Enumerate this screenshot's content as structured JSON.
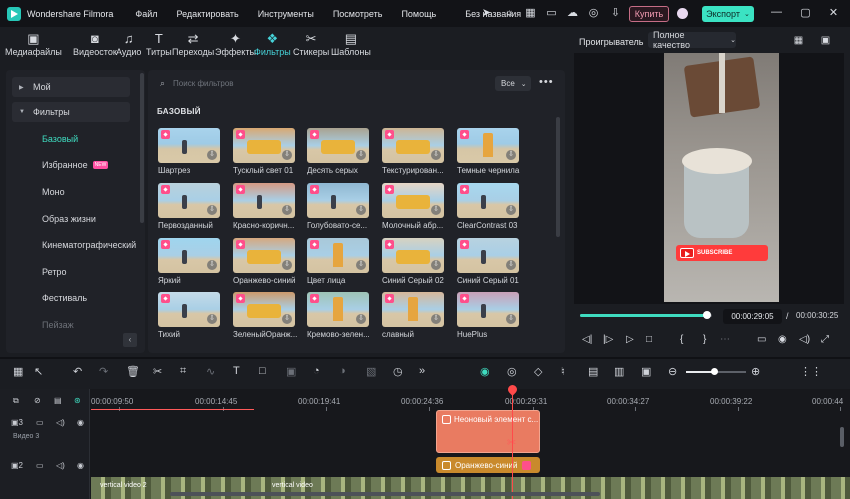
{
  "titlebar": {
    "app_name": "Wondershare Filmora",
    "menu": [
      "Файл",
      "Редактировать",
      "Инструменты",
      "Посмотреть",
      "Помощь"
    ],
    "project_name": "Без названия",
    "buy_label": "Купить",
    "export_label": "Экспорт"
  },
  "media_tabs": [
    {
      "label": "Медиафайлы",
      "icon": "media-icon"
    },
    {
      "label": "Видеосток",
      "icon": "stock-video-icon"
    },
    {
      "label": "Аудио",
      "icon": "music-note-icon"
    },
    {
      "label": "Титры",
      "icon": "title-t-icon"
    },
    {
      "label": "Переходы",
      "icon": "transition-icon"
    },
    {
      "label": "Эффекты",
      "icon": "effects-icon"
    },
    {
      "label": "Фильтры",
      "icon": "filters-icon",
      "active": true
    },
    {
      "label": "Стикеры",
      "icon": "sticker-icon"
    },
    {
      "label": "Шаблоны",
      "icon": "templates-icon"
    }
  ],
  "sidebar": {
    "groups": [
      "Мой",
      "Фильтры"
    ],
    "items": [
      "Базовый",
      "Избранное",
      "Моно",
      "Образ жизни",
      "Кинематографический",
      "Ретро",
      "Фестиваль",
      "Пейзаж"
    ],
    "new_badge": "NEW"
  },
  "filters": {
    "search_placeholder": "Поиск фильтров",
    "sort_value": "Все",
    "section_title": "БАЗОВЫЙ",
    "items": [
      "Шартрез",
      "Тусклый свет 01",
      "Десять серых",
      "Текстурирован...",
      "Темные чернила",
      "Первозданный",
      "Красно-коричн...",
      "Голубовато-се...",
      "Молочный абр...",
      "ClearContrast 03",
      "Яркий",
      "Оранжево-синий",
      "Цвет лица",
      "Синий Серый 02",
      "Синий Серый 01",
      "Тихий",
      "ЗеленыйОранж...",
      "Кремово-зелен...",
      "славный",
      "HuePlus"
    ]
  },
  "preview": {
    "label": "Проигрыватель",
    "quality": "Полное качество",
    "overlay_text": "SUBSCRIBE",
    "progress": 0.96,
    "current_time": "00:00:29:05",
    "separator": "/",
    "total_time": "00:00:30:25"
  },
  "timeline": {
    "ruler": [
      "00:00:09:50",
      "00:00:14:45",
      "00:00:19:41",
      "00:00:24:36",
      "00:00:29:31",
      "00:00:34:27",
      "00:00:39:22",
      "00:00:44"
    ],
    "track3_label": "Видео 3",
    "clip_neon": "Неоновый элемент с...",
    "clip_orange": "Оранжево-синий",
    "clip_video": "vertical video 2",
    "clip_video2": "vertical video"
  }
}
